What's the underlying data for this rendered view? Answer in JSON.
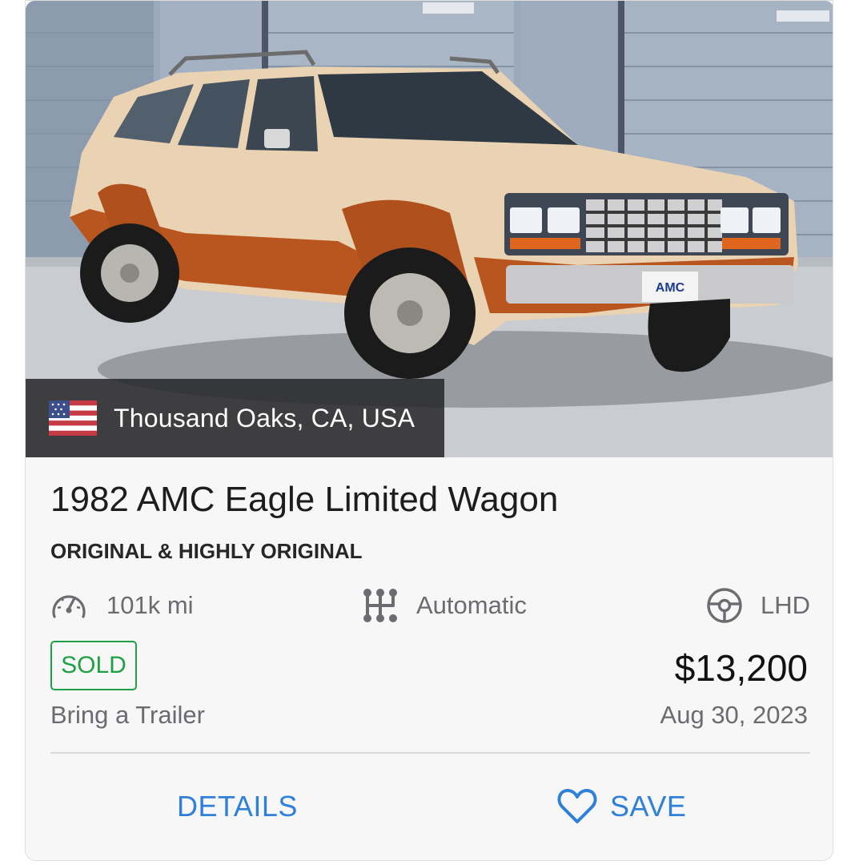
{
  "listing": {
    "location": "Thousand Oaks, CA, USA",
    "title": "1982 AMC Eagle Limited Wagon",
    "subtitle": "ORIGINAL & HIGHLY ORIGINAL",
    "photo_badge": "AMC"
  },
  "specs": {
    "mileage": "101k mi",
    "transmission": "Automatic",
    "drive_side": "LHD"
  },
  "sale": {
    "status": "SOLD",
    "price": "$13,200",
    "seller": "Bring a Trailer",
    "date": "Aug 30, 2023"
  },
  "actions": {
    "details_label": "DETAILS",
    "save_label": "SAVE"
  },
  "icons": {
    "location_flag": "us-flag-icon",
    "mileage": "speedometer-icon",
    "transmission": "gear-shifter-icon",
    "drive_side": "steering-wheel-icon",
    "save": "heart-outline-icon"
  },
  "colors": {
    "accent": "#2f80d8",
    "sold": "#1fa045",
    "text_primary": "#1d1d1f",
    "text_secondary": "#6b6b70",
    "location_bar": "#262628",
    "car_body": "#e9d3b2",
    "car_trim": "#b9551f"
  }
}
